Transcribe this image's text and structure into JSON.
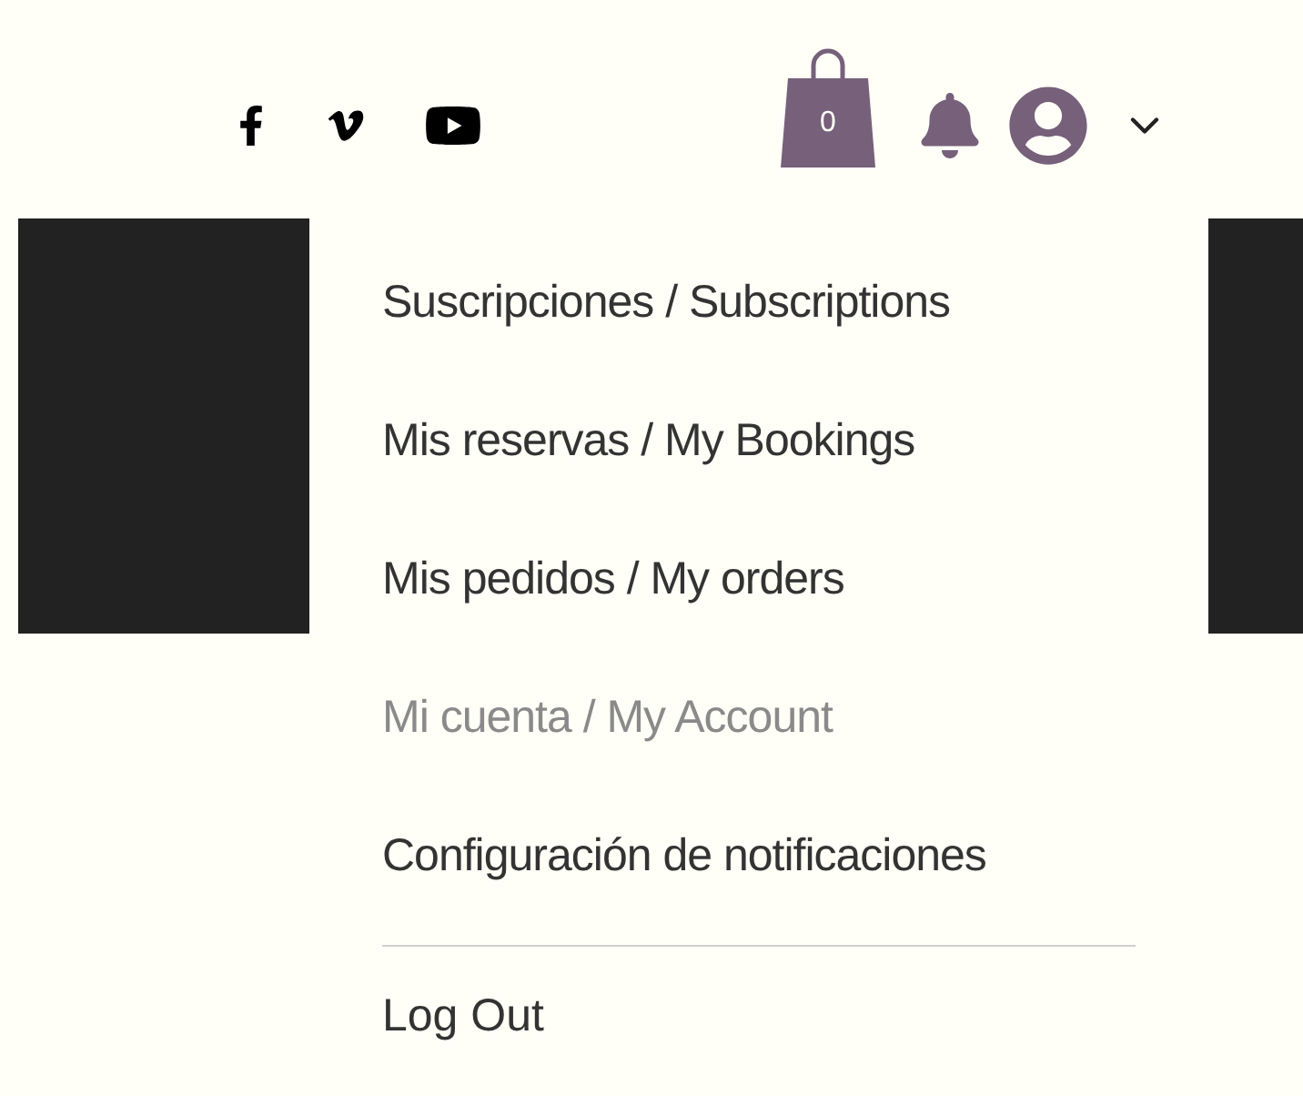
{
  "header": {
    "cart_count": "0"
  },
  "menu": {
    "items": [
      {
        "label": "Suscripciones / Subscriptions",
        "selected": false
      },
      {
        "label": "Mis reservas / My Bookings",
        "selected": false
      },
      {
        "label": "Mis pedidos / My orders",
        "selected": false
      },
      {
        "label": "Mi cuenta / My Account",
        "selected": true
      },
      {
        "label": "Configuración de notificaciones",
        "selected": false
      }
    ],
    "logout": "Log Out"
  }
}
